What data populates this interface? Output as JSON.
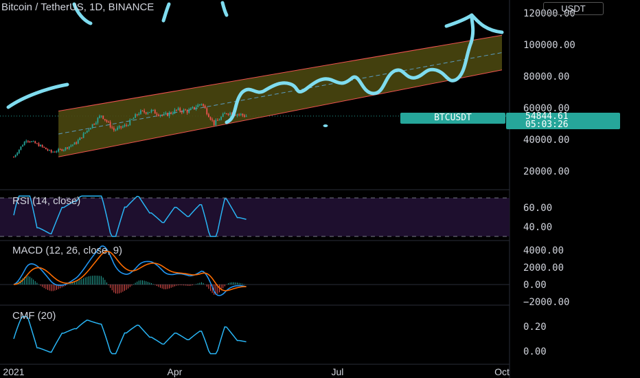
{
  "header": {
    "symbol_title": "Bitcoin / TetherUS, 1D, BINANCE",
    "currency_badge": "USDT"
  },
  "price_tag": {
    "ticker": "BTCUSDT",
    "price": "54844.61",
    "countdown": "05:03:26"
  },
  "panes": {
    "rsi_title": "RSI (14, close)",
    "macd_title": "MACD (12, 26, close, 9)",
    "cmf_title": "CMF (20)"
  },
  "colors": {
    "up": "#26a69a",
    "down": "#ef5350",
    "channel_fill": "#4a4710",
    "channel_line": "#ef5350",
    "drawing": "#7fdcef",
    "rsi_band": "#1e0f2e",
    "macd_line": "#2196f3",
    "signal_line": "#ff6d00",
    "indicator_line": "#29b6f6",
    "tag_bg": "#26a69a"
  },
  "chart_data": [
    {
      "type": "candlestick",
      "title": "Bitcoin / TetherUS, 1D, BINANCE",
      "x_ticks": [
        "2021",
        "Apr",
        "Jul",
        "Oct"
      ],
      "y_ticks": [
        20000,
        40000,
        60000,
        80000,
        100000,
        120000
      ],
      "ylim": [
        5000,
        128000
      ],
      "last_price": 54844.61,
      "approx_close_series": [
        {
          "x": "2021-01-01",
          "y": 29000
        },
        {
          "x": "2021-01-08",
          "y": 40000
        },
        {
          "x": "2021-01-15",
          "y": 36500
        },
        {
          "x": "2021-01-22",
          "y": 32000
        },
        {
          "x": "2021-01-29",
          "y": 34000
        },
        {
          "x": "2021-02-05",
          "y": 38000
        },
        {
          "x": "2021-02-12",
          "y": 47000
        },
        {
          "x": "2021-02-19",
          "y": 55500
        },
        {
          "x": "2021-02-26",
          "y": 46000
        },
        {
          "x": "2021-03-05",
          "y": 49000
        },
        {
          "x": "2021-03-12",
          "y": 57000
        },
        {
          "x": "2021-03-19",
          "y": 58000
        },
        {
          "x": "2021-03-26",
          "y": 55000
        },
        {
          "x": "2021-04-02",
          "y": 58500
        },
        {
          "x": "2021-04-09",
          "y": 58000
        },
        {
          "x": "2021-04-16",
          "y": 63000
        },
        {
          "x": "2021-04-23",
          "y": 50000
        },
        {
          "x": "2021-04-30",
          "y": 57000
        },
        {
          "x": "2021-05-07",
          "y": 56000
        },
        {
          "x": "2021-05-11",
          "y": 54844.61
        }
      ],
      "channel": {
        "upper": [
          {
            "x": "2021-01-26",
            "y": 58000
          },
          {
            "x": "2021-10-01",
            "y": 106000
          }
        ],
        "lower": [
          {
            "x": "2021-01-26",
            "y": 29000
          },
          {
            "x": "2021-10-01",
            "y": 84000
          }
        ]
      }
    },
    {
      "type": "line",
      "title": "RSI (14, close)",
      "y_ticks": [
        40.0,
        60.0
      ],
      "bands": [
        30,
        70
      ]
    },
    {
      "type": "line",
      "title": "MACD (12, 26, close, 9)",
      "y_ticks": [
        -2000.0,
        0.0,
        2000.0,
        4000.0
      ]
    },
    {
      "type": "line",
      "title": "CMF (20)",
      "y_ticks": [
        0.0,
        0.2
      ]
    }
  ]
}
